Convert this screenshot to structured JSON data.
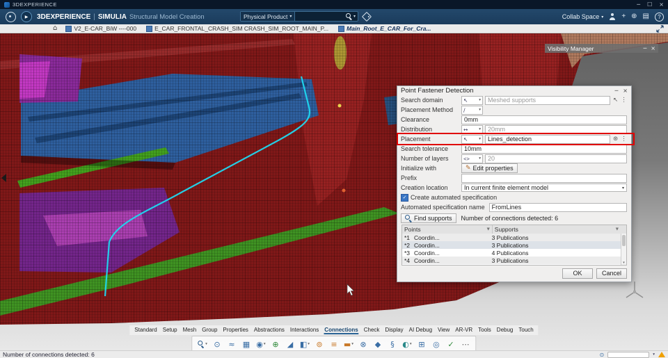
{
  "window": {
    "title": "3DEXPERIENCE",
    "minimize": "─",
    "maximize": "☐",
    "close": "×"
  },
  "header": {
    "brand": "3DEXPERIENCE",
    "separator": "|",
    "suite": "SIMULIA",
    "app": "Structural Model Creation",
    "search": {
      "context": "Physical Product"
    },
    "collab": "Collab Space"
  },
  "icons": {
    "caret": "▾",
    "kebab": "⋮",
    "cursor": "↖",
    "arrows": "↔",
    "angle": "<>",
    "slash": "∕",
    "pencil": "✎",
    "check": "✓",
    "home": "⌂",
    "funnel": "▼",
    "settings": "⊛",
    "play": "▶"
  },
  "tabbar": {
    "tabs": [
      {
        "label": "V2_E-CAR_BiW ----000",
        "active": false
      },
      {
        "label": "E_CAR_FRONTAL_CRASH_SIM CRASH_SIM_ROOT_MAIN_P...",
        "active": false
      },
      {
        "label": "Main_Root_E_CAR_For_Cra...",
        "active": true
      }
    ]
  },
  "visibility_manager": {
    "title": "Visibility Manager",
    "minimize": "─",
    "close": "×"
  },
  "dialog": {
    "title": "Point Fastener Detection",
    "minimize": "─",
    "close": "×",
    "fields": {
      "search_domain": {
        "label": "Search domain",
        "value": "Meshed supports"
      },
      "placement_method": {
        "label": "Placement Method"
      },
      "clearance": {
        "label": "Clearance",
        "value": "0mm"
      },
      "distribution": {
        "label": "Distribution",
        "value": "20mm"
      },
      "placement": {
        "label": "Placement",
        "value": "Lines_detection"
      },
      "search_tolerance": {
        "label": "Search tolerance",
        "value": "10mm"
      },
      "number_of_layers": {
        "label": "Number of layers",
        "value": "20"
      },
      "initialize_with": {
        "label": "Initialize with",
        "button": "Edit properties"
      },
      "prefix": {
        "label": "Prefix",
        "value": ""
      },
      "creation_location": {
        "label": "Creation location",
        "value": "In current finite element model"
      },
      "auto_spec": {
        "label": "Create automated specification",
        "checked": true
      },
      "auto_spec_name": {
        "label": "Automated specification name",
        "value": "FromLines"
      }
    },
    "find": {
      "button": "Find supports",
      "status": "Number of connections detected: 6"
    },
    "results": {
      "columns": [
        "Points",
        "Supports"
      ],
      "rows": [
        {
          "id": "*1",
          "name": "Coordin...",
          "support": "3 Publications",
          "state": "shade"
        },
        {
          "id": "*2",
          "name": "Coordin...",
          "support": "3 Publications",
          "state": "sel"
        },
        {
          "id": "*3",
          "name": "Coordin...",
          "support": "4 Publications",
          "state": ""
        },
        {
          "id": "*4",
          "name": "Coordin...",
          "support": "3 Publications",
          "state": "shade"
        }
      ]
    },
    "ok": "OK",
    "cancel": "Cancel"
  },
  "ribbon": {
    "tabs": [
      "Standard",
      "Setup",
      "Mesh",
      "Group",
      "Properties",
      "Abstractions",
      "Interactions",
      "Connections",
      "Check",
      "Display",
      "AI Debug",
      "View",
      "AR-VR",
      "Tools",
      "Debug",
      "Touch"
    ],
    "active": "Connections",
    "icons": [
      {
        "name": "search-tools-icon",
        "shape": "magnifier",
        "caret": true
      },
      {
        "name": "point-fastener-icon",
        "glyph": "⊙",
        "color": "#3a6ea5"
      },
      {
        "name": "curve-fastener-icon",
        "glyph": "≈",
        "color": "#3a6ea5"
      },
      {
        "name": "surface-fastener-icon",
        "glyph": "▦",
        "color": "#3a6ea5"
      },
      {
        "name": "fastener-review-icon",
        "glyph": "◉",
        "color": "#3a6ea5",
        "caret": true
      },
      {
        "name": "connection-point-icon",
        "glyph": "⊕",
        "color": "#2f8a3a"
      },
      {
        "name": "connection-line-icon",
        "glyph": "◢",
        "color": "#3a6ea5"
      },
      {
        "name": "connection-surface-icon",
        "glyph": "◧",
        "color": "#3a6ea5",
        "caret": true
      },
      {
        "name": "spot-weld-icon",
        "glyph": "⊚",
        "color": "#c87a2a"
      },
      {
        "name": "seam-weld-icon",
        "glyph": "≡",
        "color": "#c87a2a"
      },
      {
        "name": "adhesive-icon",
        "glyph": "▬",
        "color": "#c87a2a",
        "caret": true
      },
      {
        "name": "bolt-icon",
        "glyph": "⊗",
        "color": "#3a6ea5"
      },
      {
        "name": "rigid-connection-icon",
        "glyph": "◆",
        "color": "#3a6ea5"
      },
      {
        "name": "spring-connection-icon",
        "glyph": "§",
        "color": "#3a6ea5"
      },
      {
        "name": "contact-icon",
        "glyph": "◐",
        "color": "#2a8a8a",
        "caret": true
      },
      {
        "name": "tie-icon",
        "glyph": "⊞",
        "color": "#3a6ea5"
      },
      {
        "name": "coupling-icon",
        "glyph": "◎",
        "color": "#3a6ea5"
      },
      {
        "name": "check-connections-icon",
        "glyph": "✓",
        "color": "#2f8a3a"
      },
      {
        "name": "more-tools-icon",
        "glyph": "⋯",
        "color": "#555"
      }
    ]
  },
  "statusbar": {
    "message": "Number of connections detected: 6"
  },
  "colors": {
    "header_blue": "#1e4060",
    "accent_blue": "#2a6496",
    "highlight_red": "#e00000",
    "mesh_red": "#801818",
    "panel_blue": "#2e5f9e",
    "panel_purple": "#73258a",
    "panel_green": "#3f9222",
    "edge_cyan": "#1fd8f0",
    "warning_orange": "#f0a000"
  }
}
